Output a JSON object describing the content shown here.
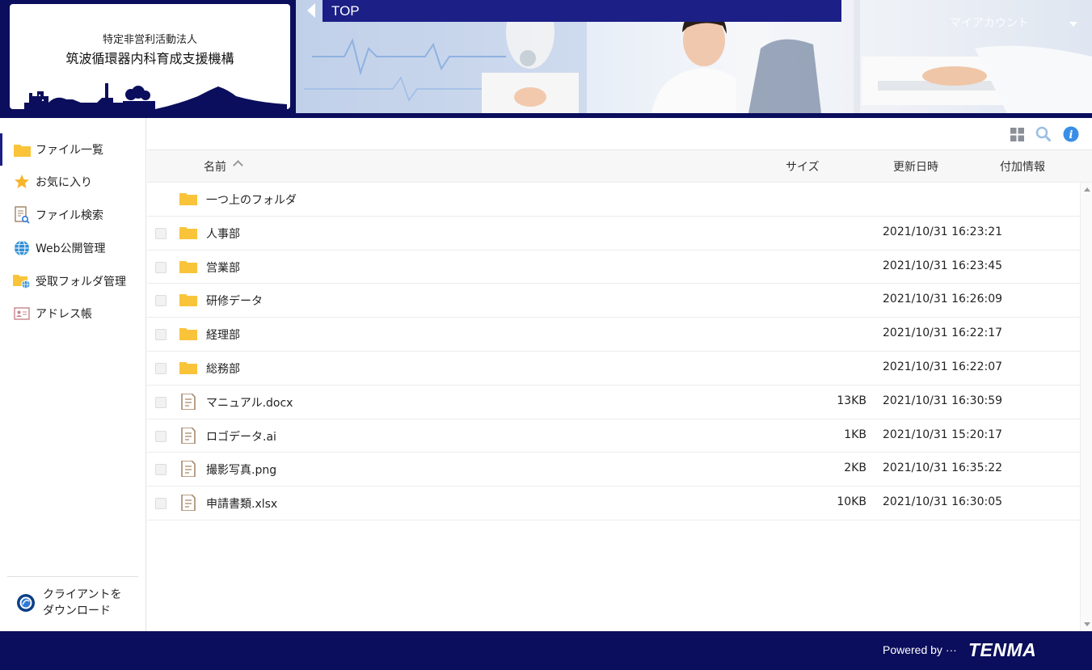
{
  "header": {
    "org_line1": "特定非営利活動法人",
    "org_line2": "筑波循環器内科育成支援機構",
    "breadcrumb": "TOP",
    "account_label": "マイアカウント"
  },
  "sidebar": {
    "items": [
      {
        "label": "ファイル一覧",
        "icon": "folder-icon"
      },
      {
        "label": "お気に入り",
        "icon": "star-icon"
      },
      {
        "label": "ファイル検索",
        "icon": "file-search-icon"
      },
      {
        "label": "Web公開管理",
        "icon": "globe-icon"
      },
      {
        "label": "受取フォルダ管理",
        "icon": "folder-globe-icon"
      },
      {
        "label": "アドレス帳",
        "icon": "address-card-icon"
      }
    ],
    "client_download": "クライアントをダウンロード"
  },
  "toolbar": {
    "icons": [
      "grid-view-icon",
      "search-icon",
      "info-icon"
    ]
  },
  "table": {
    "headers": {
      "name": "名前",
      "size": "サイズ",
      "date": "更新日時",
      "info": "付加情報"
    },
    "parent_folder": "一つ上のフォルダ",
    "rows": [
      {
        "type": "folder",
        "name": "人事部",
        "size": "",
        "date": "2021/10/31 16:23:21"
      },
      {
        "type": "folder",
        "name": "営業部",
        "size": "",
        "date": "2021/10/31 16:23:45"
      },
      {
        "type": "folder",
        "name": "研修データ",
        "size": "",
        "date": "2021/10/31 16:26:09"
      },
      {
        "type": "folder",
        "name": "経理部",
        "size": "",
        "date": "2021/10/31 16:22:17"
      },
      {
        "type": "folder",
        "name": "総務部",
        "size": "",
        "date": "2021/10/31 16:22:07"
      },
      {
        "type": "file",
        "name": "マニュアル.docx",
        "size": "13KB",
        "date": "2021/10/31 16:30:59"
      },
      {
        "type": "file",
        "name": "ロゴデータ.ai",
        "size": "1KB",
        "date": "2021/10/31 15:20:17"
      },
      {
        "type": "file",
        "name": "撮影写真.png",
        "size": "2KB",
        "date": "2021/10/31 16:35:22"
      },
      {
        "type": "file",
        "name": "申請書類.xlsx",
        "size": "10KB",
        "date": "2021/10/31 16:30:05"
      }
    ]
  },
  "footer": {
    "powered_by": "Powered by ···",
    "brand": "TENMA"
  },
  "colors": {
    "navy": "#0b0e5c",
    "breadcrumb": "#1b1f86",
    "folder": "#f9c43a",
    "info": "#3a8ee6"
  }
}
